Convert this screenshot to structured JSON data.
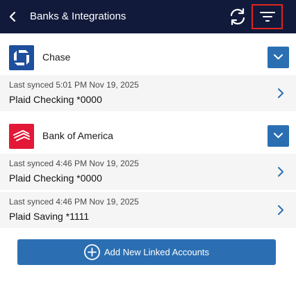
{
  "header": {
    "title": "Banks & Integrations",
    "back_icon": "chevron-left-icon",
    "refresh_icon": "refresh-icon",
    "filter_icon": "filter-icon"
  },
  "banks": [
    {
      "name": "Chase",
      "logo_icon": "chase-logo",
      "accounts": [
        {
          "last_synced": "Last synced 5:01 PM Nov 19, 2025",
          "name": "Plaid Checking *0000"
        }
      ]
    },
    {
      "name": "Bank of America",
      "logo_icon": "bank-of-america-logo",
      "accounts": [
        {
          "last_synced": "Last synced 4:46 PM Nov 19, 2025",
          "name": "Plaid Checking *0000"
        },
        {
          "last_synced": "Last synced 4:46 PM Nov 19, 2025",
          "name": "Plaid Saving *1111"
        }
      ]
    }
  ],
  "add_button": {
    "label": "Add New Linked Accounts",
    "icon": "plus-circle-icon"
  },
  "colors": {
    "header_bg": "#121a3b",
    "accent": "#2b6fb2",
    "highlight_border": "#e0241c",
    "row_bg": "#f5f5f5"
  }
}
